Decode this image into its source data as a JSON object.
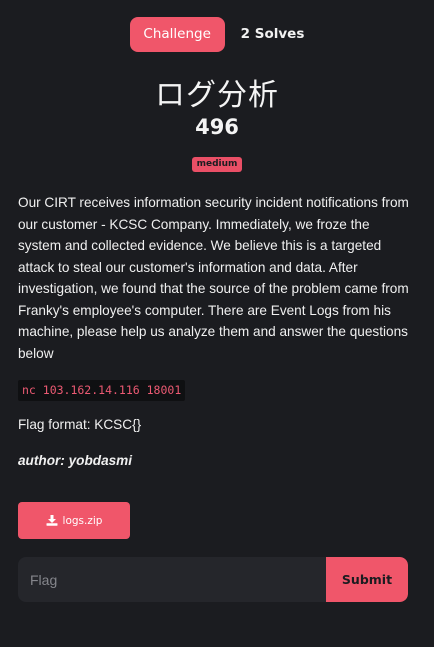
{
  "tabs": {
    "challenge_label": "Challenge",
    "solves_label": "2 Solves"
  },
  "challenge": {
    "title": "ログ分析",
    "points": "496",
    "difficulty": "medium",
    "description": "Our CIRT receives information security incident notifications from our customer - KCSC Company. Immediately, we froze the system and collected evidence. We believe this is a targeted attack to steal our customer's information and data. After investigation, we found that the source of the problem came from Franky's employee's computer. There are Event Logs from his machine, please help us analyze them and answer the questions below",
    "connection": "nc 103.162.14.116 18001",
    "flag_format": "Flag format: KCSC{}",
    "author": "author: yobdasmi"
  },
  "download": {
    "icon": "download-icon",
    "label": "logs.zip"
  },
  "submission": {
    "placeholder": "Flag",
    "value": "",
    "submit_label": "Submit"
  },
  "colors": {
    "background": "#1b1c20",
    "accent": "#f0566a",
    "code_text": "#ec5a73",
    "input_background": "#25262b"
  }
}
